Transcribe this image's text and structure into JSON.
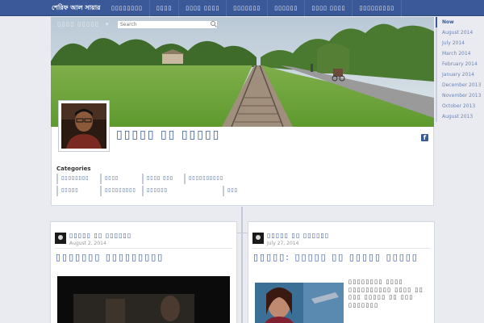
{
  "header": {
    "brand": "শেরিফ আল সায়ার",
    "nav": [
      "▯▯▯▯▯▯▯▯",
      "▯▯▯▯",
      "▯▯▯▯ ▯▯▯▯",
      "▯▯▯▯▯▯▯",
      "▯▯▯▯▯▯",
      "▯▯▯▯ ▯▯▯▯",
      "▯▯▯▯▯▯▯▯▯"
    ]
  },
  "cover": {
    "name": "▯▯▯▯ ▯▯▯▯▯",
    "caret": "▾",
    "search_placeholder": "Search"
  },
  "profile": {
    "title": "▯▯▯▯▯ ▯▯ ▯▯▯▯▯",
    "fb_letter": "f"
  },
  "categories": {
    "heading": "Categories",
    "items": [
      "▯▯▯▯▯▯▯▯",
      "▯▯▯▯",
      "▯▯▯▯ ▯▯▯",
      "▯▯▯▯▯▯▯▯▯▯",
      "▯▯▯▯▯",
      "▯▯▯▯▯▯▯▯▯",
      "▯▯▯▯▯▯",
      "▯▯▯"
    ]
  },
  "archive": {
    "items": [
      "Now",
      "August 2014",
      "July 2014",
      "March 2014",
      "February 2014",
      "January 2014",
      "December 2013",
      "November 2013",
      "October 2013",
      "August 2013"
    ]
  },
  "posts": [
    {
      "title": "▯▯▯▯▯ ▯▯ ▯▯▯▯▯▯",
      "date": "August 2, 2014",
      "heading": "▯▯▯▯▯▯▯ ▯▯▯▯▯▯▯▯▯"
    },
    {
      "title": "▯▯▯▯▯ ▯▯ ▯▯▯▯▯▯",
      "date": "July 27, 2014",
      "heading": "▯▯▯▯▯: ▯▯▯▯▯ ▯▯ ▯▯▯▯▯ ▯▯▯▯▯",
      "excerpt": "▯▯▯▯▯▯▯▯ ▯▯▯▯ ▯▯▯▯▯▯▯▯▯▯ ▯▯▯▯ ▯▯ ▯▯▯ ▯▯▯▯▯ ▯▯ ▯▯▯ ▯▯▯▯▯▯▯"
    }
  ],
  "colors": {
    "brand_blue": "#3b5998",
    "link_blue": "#6d84b4",
    "page_bg": "#e9ebf1"
  }
}
